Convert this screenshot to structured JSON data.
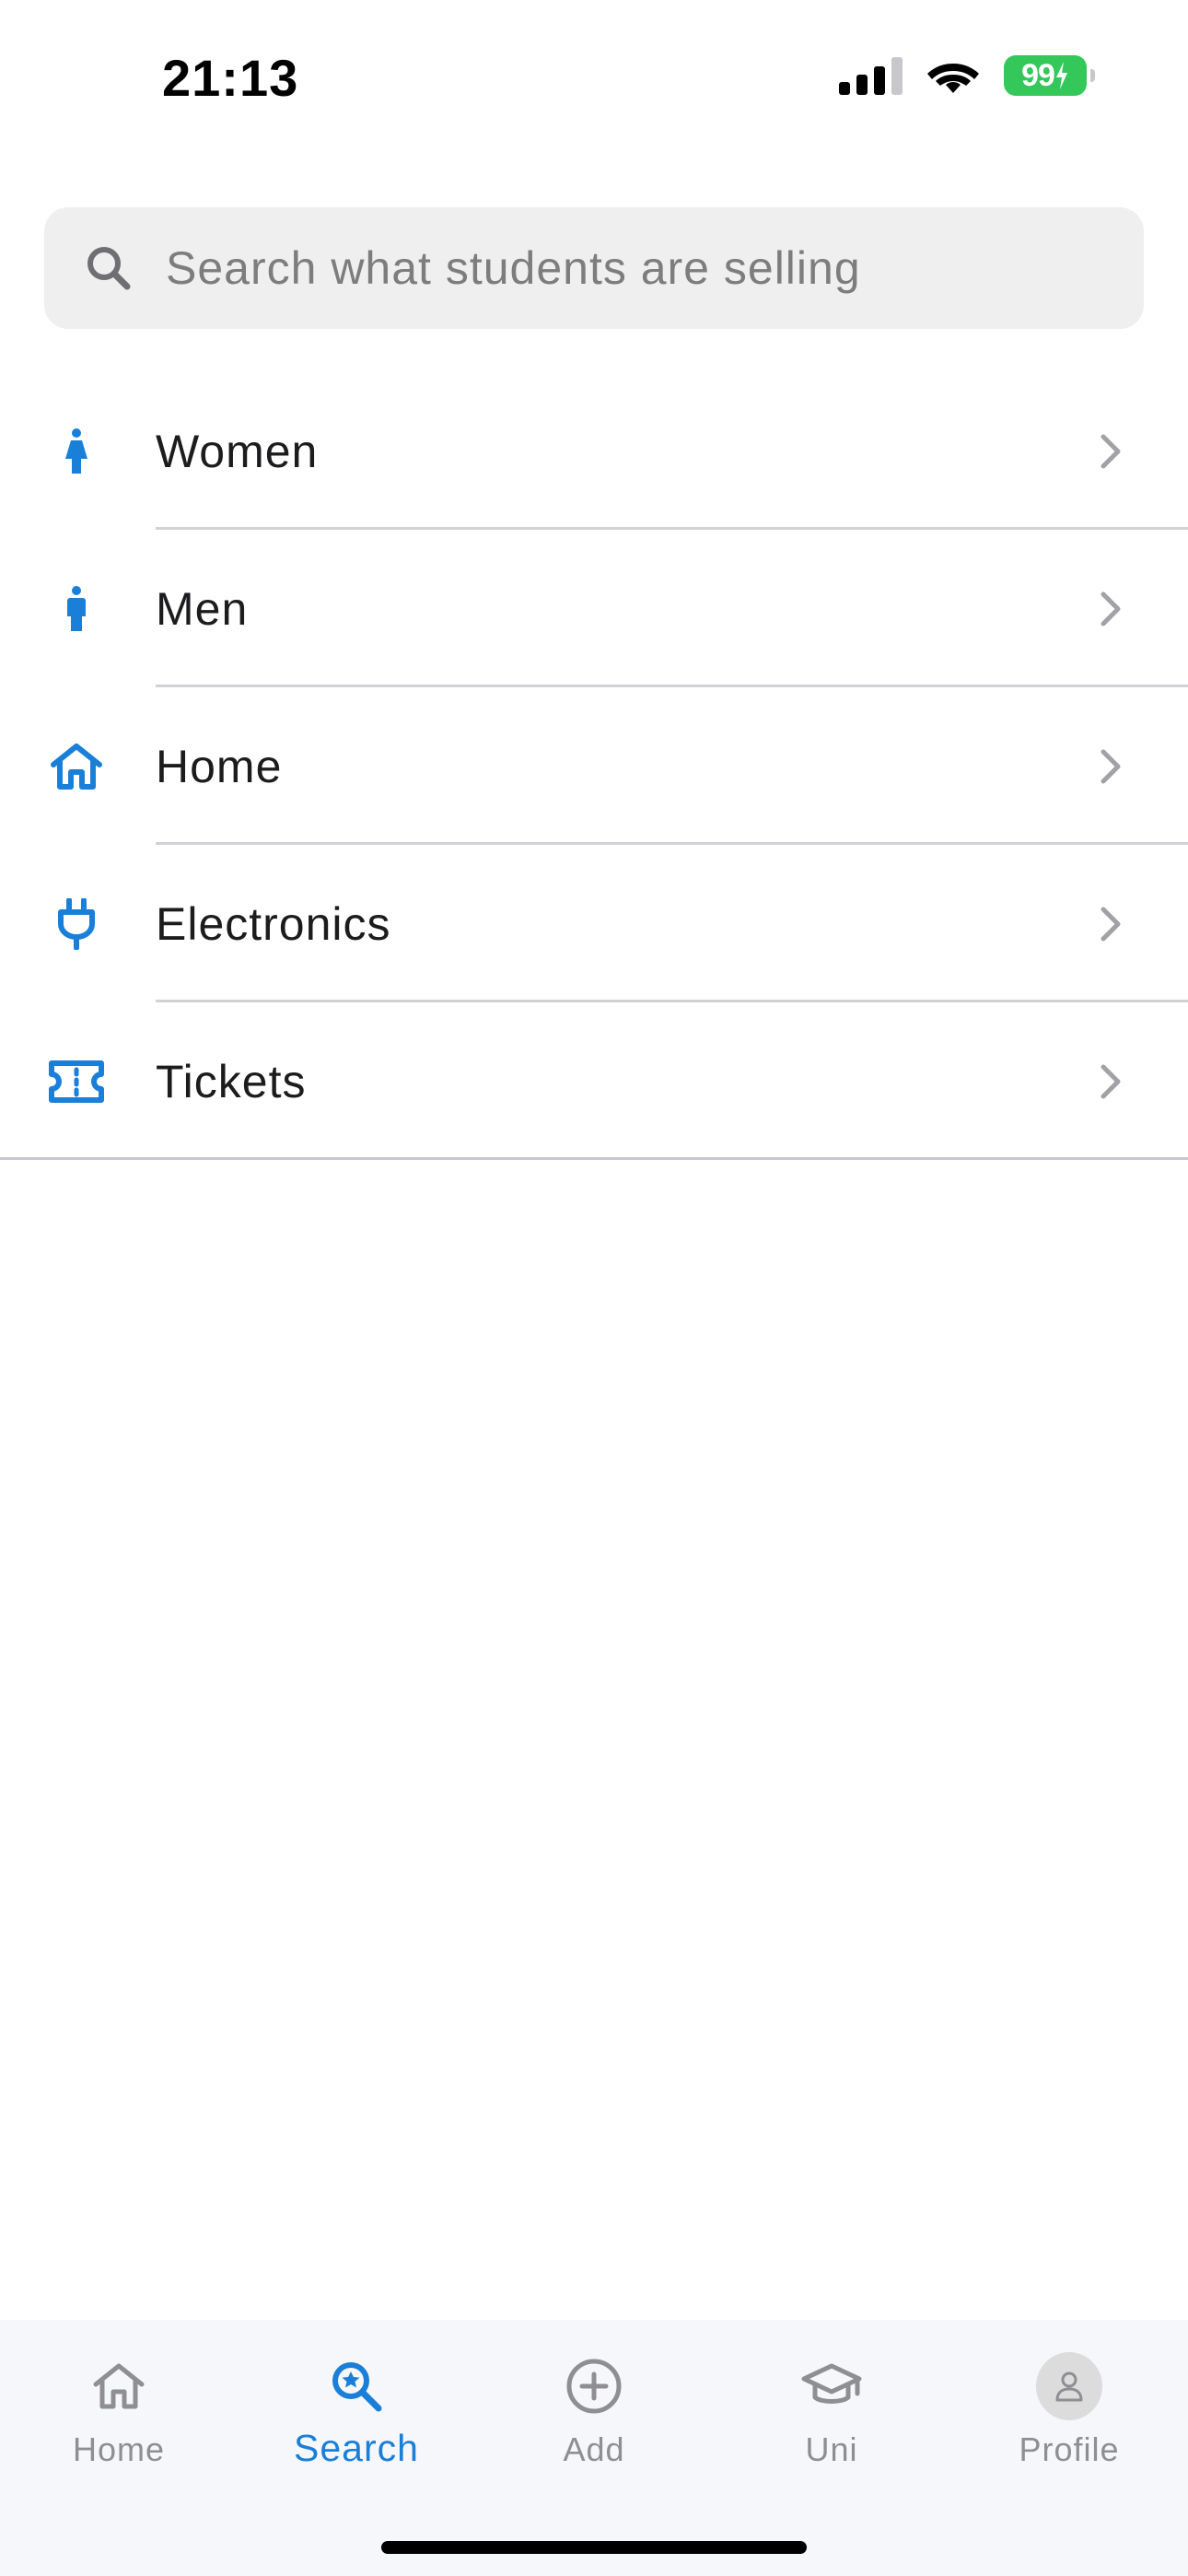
{
  "status_bar": {
    "time": "21:13",
    "battery": "99",
    "battery_color": "#34c759"
  },
  "search": {
    "placeholder": "Search what students are selling",
    "icon": "search-icon"
  },
  "accent_color": "#1a7fd9",
  "categories": [
    {
      "label": "Women",
      "icon": "woman-icon"
    },
    {
      "label": "Men",
      "icon": "man-icon"
    },
    {
      "label": "Home",
      "icon": "house-icon"
    },
    {
      "label": "Electronics",
      "icon": "plug-icon"
    },
    {
      "label": "Tickets",
      "icon": "ticket-icon"
    }
  ],
  "tab_bar": {
    "active": "Search",
    "tabs": [
      {
        "label": "Home",
        "icon": "house-icon"
      },
      {
        "label": "Search",
        "icon": "search-star-icon"
      },
      {
        "label": "Add",
        "icon": "plus-circle-icon"
      },
      {
        "label": "Uni",
        "icon": "graduation-cap-icon"
      },
      {
        "label": "Profile",
        "icon": "avatar-icon"
      }
    ]
  }
}
